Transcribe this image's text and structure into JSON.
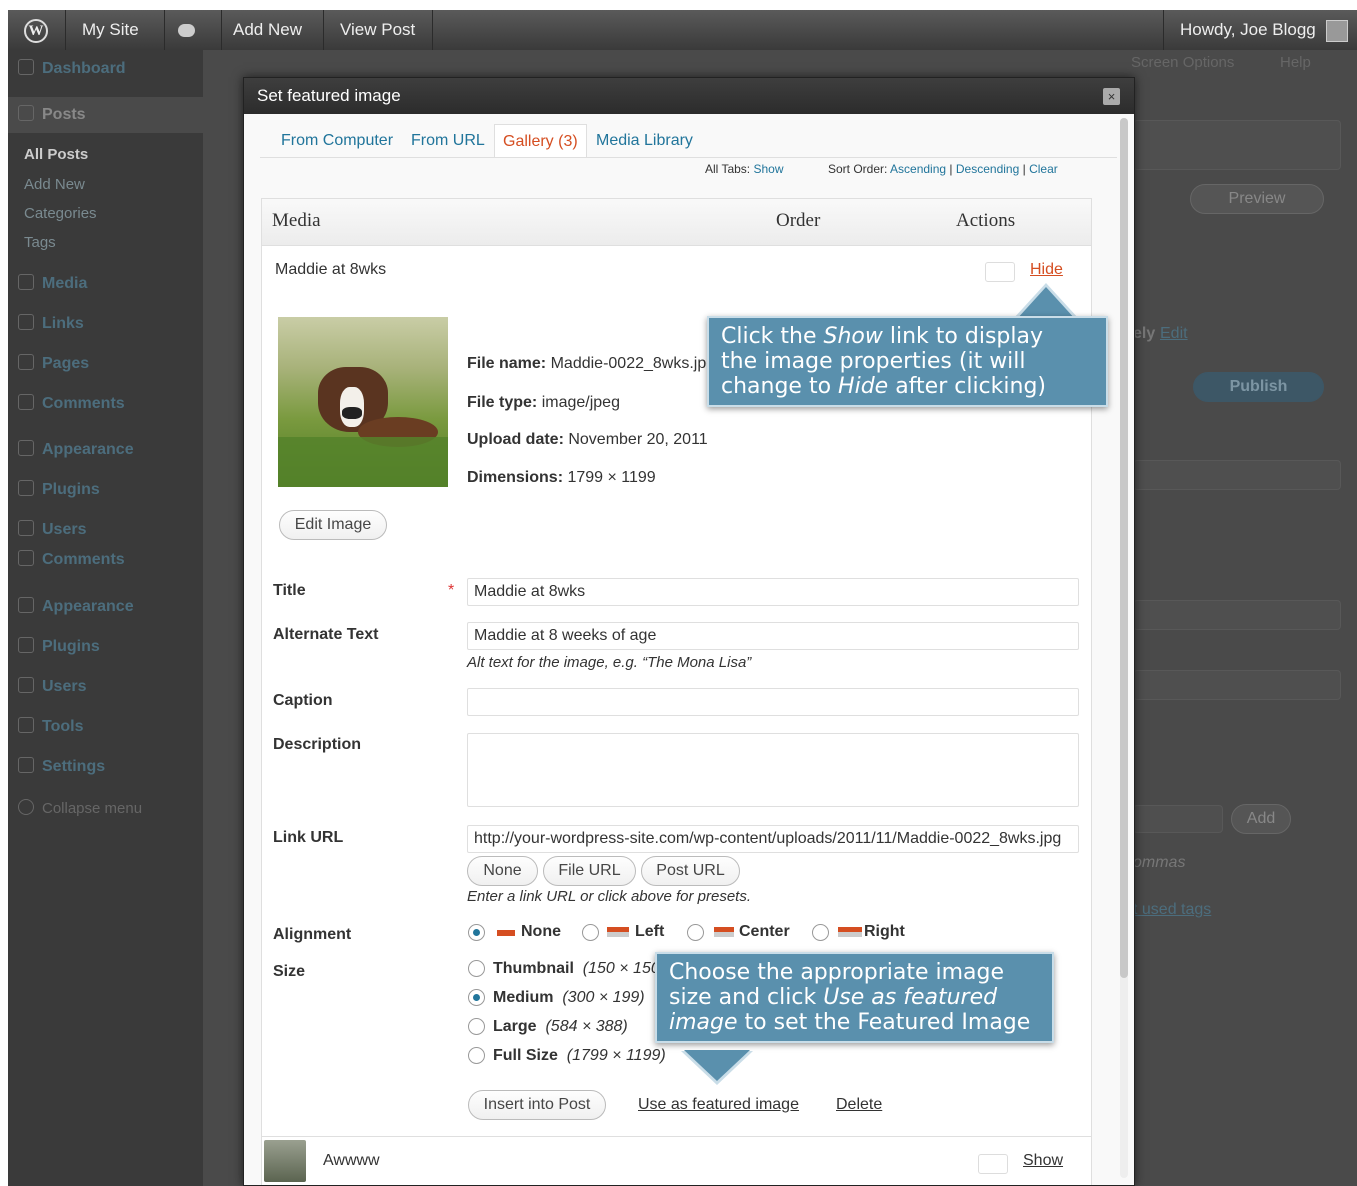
{
  "admin_bar": {
    "wp_logo": "W",
    "site_name": "My Site",
    "add_new": "Add New",
    "view_post": "View Post",
    "howdy": "Howdy, Joe Blogg"
  },
  "sidebar": {
    "items": [
      {
        "label": "Dashboard"
      },
      {
        "label": "Posts"
      },
      {
        "label": "Media"
      },
      {
        "label": "Links"
      },
      {
        "label": "Pages"
      },
      {
        "label": "Comments"
      },
      {
        "label": "Appearance"
      },
      {
        "label": "Plugins"
      },
      {
        "label": "Users"
      },
      {
        "label": "Comments"
      },
      {
        "label": "Appearance"
      },
      {
        "label": "Plugins"
      },
      {
        "label": "Users"
      },
      {
        "label": "Tools"
      },
      {
        "label": "Settings"
      },
      {
        "label": "Collapse menu"
      }
    ],
    "posts_sub": [
      "All Posts",
      "Add New",
      "Categories",
      "Tags"
    ]
  },
  "background": {
    "screen_options": "Screen Options",
    "help": "Help",
    "preview": "Preview",
    "publish": "Publish",
    "edit": "Edit",
    "add": "Add",
    "commas": "ommas",
    "used_tags": "t used tags",
    "ely": "ely"
  },
  "modal": {
    "title": "Set featured image",
    "close": "×",
    "tabs": [
      "From Computer",
      "From URL",
      "Gallery (3)",
      "Media Library"
    ],
    "all_tabs_label": "All Tabs:",
    "all_tabs_show": "Show",
    "sort_order_label": "Sort Order:",
    "sort_ascending": "Ascending",
    "sort_descending": "Descending",
    "sort_clear": "Clear",
    "sort_sep": "|",
    "table_headers": {
      "media": "Media",
      "order": "Order",
      "actions": "Actions"
    },
    "item": {
      "name": "Maddie at 8wks",
      "hide_link": "Hide",
      "file_name_label": "File name:",
      "file_name": "Maddie-0022_8wks.jpg",
      "file_type_label": "File type:",
      "file_type": "image/jpeg",
      "upload_date_label": "Upload date:",
      "upload_date": "November 20, 2011",
      "dimensions_label": "Dimensions:",
      "dimensions": "1799 × 1199",
      "edit_image": "Edit Image"
    },
    "fields": {
      "title_label": "Title",
      "required_mark": "*",
      "title_value": "Maddie at 8wks",
      "alt_label": "Alternate Text",
      "alt_value": "Maddie at 8 weeks of age",
      "alt_help": "Alt text for the image, e.g. “The Mona Lisa”",
      "caption_label": "Caption",
      "caption_value": "",
      "description_label": "Description",
      "description_value": "",
      "link_label": "Link URL",
      "link_value": "http://your-wordpress-site.com/wp-content/uploads/2011/11/Maddie-0022_8wks.jpg",
      "link_none": "None",
      "link_file": "File URL",
      "link_post": "Post URL",
      "link_help": "Enter a link URL or click above for presets.",
      "alignment_label": "Alignment",
      "align_none": "None",
      "align_left": "Left",
      "align_center": "Center",
      "align_right": "Right",
      "size_label": "Size",
      "size_thumbnail": "Thumbnail",
      "size_thumbnail_dim": "(150 × 150)",
      "size_medium": "Medium",
      "size_medium_dim": "(300 × 199)",
      "size_large": "Large",
      "size_large_dim": "(584 × 388)",
      "size_full": "Full Size",
      "size_full_dim": "(1799 × 1199)",
      "insert_button": "Insert into Post",
      "use_featured": "Use as featured image",
      "delete": "Delete"
    },
    "next_item": {
      "name": "Awwww",
      "show_link": "Show"
    }
  },
  "tooltips": {
    "show_tip": {
      "line1_a": "Click the ",
      "line1_em": "Show",
      "line1_b": " link to display",
      "line2": "the image properties (it will",
      "line3_a": "change to ",
      "line3_em": "Hide",
      "line3_b": " after clicking)"
    },
    "size_tip": {
      "line1": "Choose the appropriate image",
      "line2_a": "size and click ",
      "line2_em": "Use as featured",
      "line3_em": "image",
      "line3_b": " to set the Featured Image"
    }
  },
  "colors": {
    "link": "#21759b",
    "active_tab": "#d54e21",
    "tooltip_bg": "#5a90ad",
    "admin_bar": "#464646"
  }
}
